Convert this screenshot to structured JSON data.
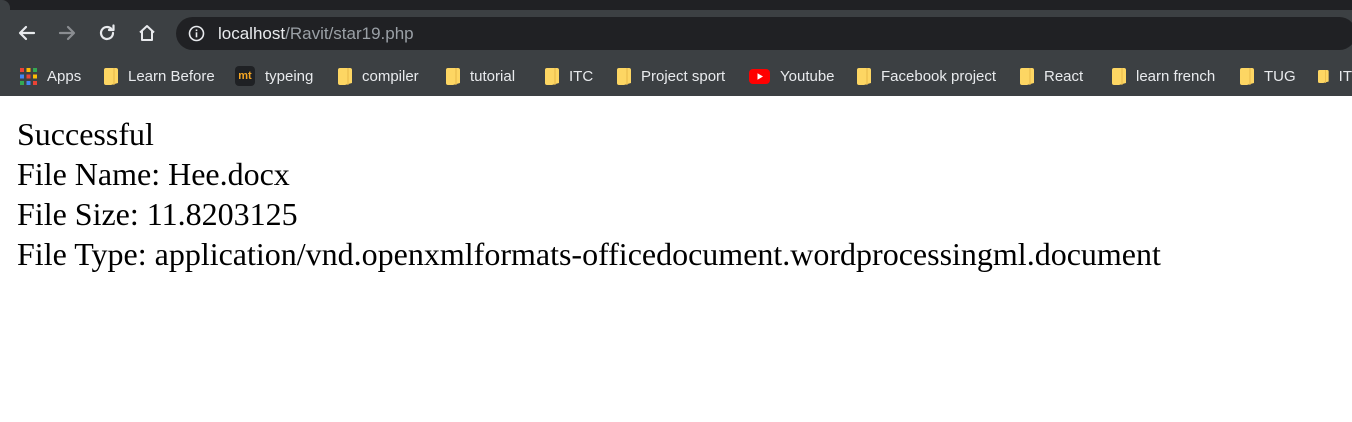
{
  "browser": {
    "url_host": "localhost",
    "url_path": "/Ravit/star19.php",
    "icons": {
      "back": "arrow-left-icon",
      "forward": "arrow-right-icon",
      "reload": "reload-icon",
      "home": "home-icon",
      "site_info": "info-icon"
    },
    "bookmarks": [
      {
        "label": "Apps",
        "icon": "apps-grid-icon"
      },
      {
        "label": "Learn Before",
        "icon": "folder-icon"
      },
      {
        "label": "typeing",
        "icon": "mt-logo-icon"
      },
      {
        "label": "compiler",
        "icon": "folder-icon"
      },
      {
        "label": "tutorial",
        "icon": "folder-icon"
      },
      {
        "label": "ITC",
        "icon": "folder-icon"
      },
      {
        "label": "Project sport",
        "icon": "folder-icon"
      },
      {
        "label": "Youtube",
        "icon": "youtube-icon"
      },
      {
        "label": "Facebook project",
        "icon": "folder-icon"
      },
      {
        "label": "React",
        "icon": "folder-icon"
      },
      {
        "label": "learn french",
        "icon": "folder-icon"
      },
      {
        "label": "TUG",
        "icon": "folder-icon"
      },
      {
        "label": "IT",
        "icon": "folder-icon"
      }
    ],
    "colors": {
      "toolbar": "#3c4043",
      "omnibox": "#202124",
      "folder": "#fdd663",
      "youtube": "#ff0000"
    }
  },
  "page": {
    "lines": [
      "Successful",
      "File Name: Hee.docx",
      "File Size: 11.8203125",
      "File Type: application/vnd.openxmlformats-officedocument.wordprocessingml.document"
    ]
  }
}
